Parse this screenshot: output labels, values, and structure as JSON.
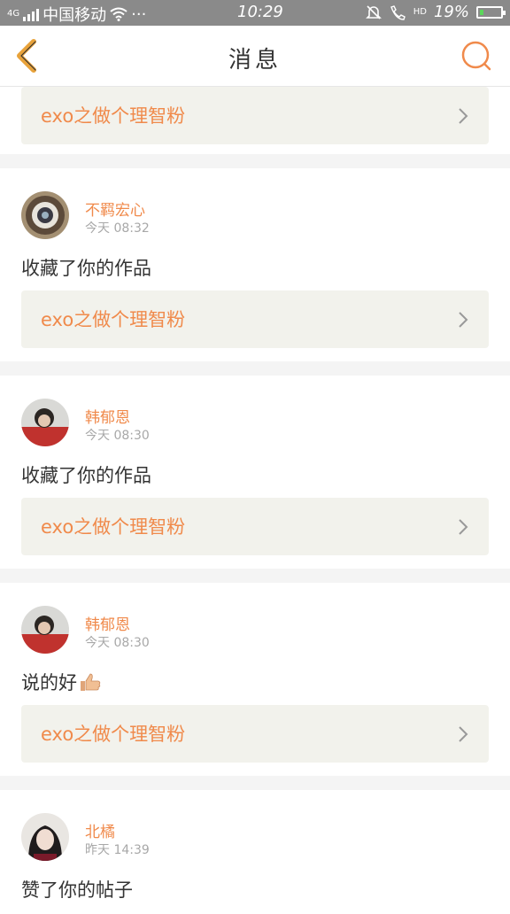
{
  "status": {
    "signal_label": "4G",
    "carrier": "中国移动",
    "dots": "···",
    "time": "10:29",
    "hd": "HD",
    "battery": "19%",
    "battery_level": 0.19,
    "icons": [
      "signal-icon",
      "wifi-icon",
      "mute-icon",
      "hd-call-icon",
      "battery-icon"
    ]
  },
  "nav": {
    "title": "消息",
    "back_icon": "chevron-left-icon",
    "search_icon": "search-icon",
    "accent": "#e8a23a",
    "search_color": "#f08a4b"
  },
  "items": [
    {
      "work": "exo之做个理智粉"
    },
    {
      "user": "不羁宏心",
      "time": "今天 08:32",
      "message": "收藏了你的作品",
      "work": "exo之做个理智粉"
    },
    {
      "user": "韩郁恩",
      "time": "今天 08:30",
      "message": "收藏了你的作品",
      "work": "exo之做个理智粉"
    },
    {
      "user": "韩郁恩",
      "time": "今天 08:30",
      "message": "说的好",
      "emoji": "thumbs-up-icon",
      "work": "exo之做个理智粉"
    },
    {
      "user": "北橘",
      "time": "昨天 14:39",
      "message": "赞了你的帖子"
    }
  ],
  "colors": {
    "name": "#f08a4b",
    "card": "#f2f2ec",
    "time": "#a8a8a8"
  }
}
